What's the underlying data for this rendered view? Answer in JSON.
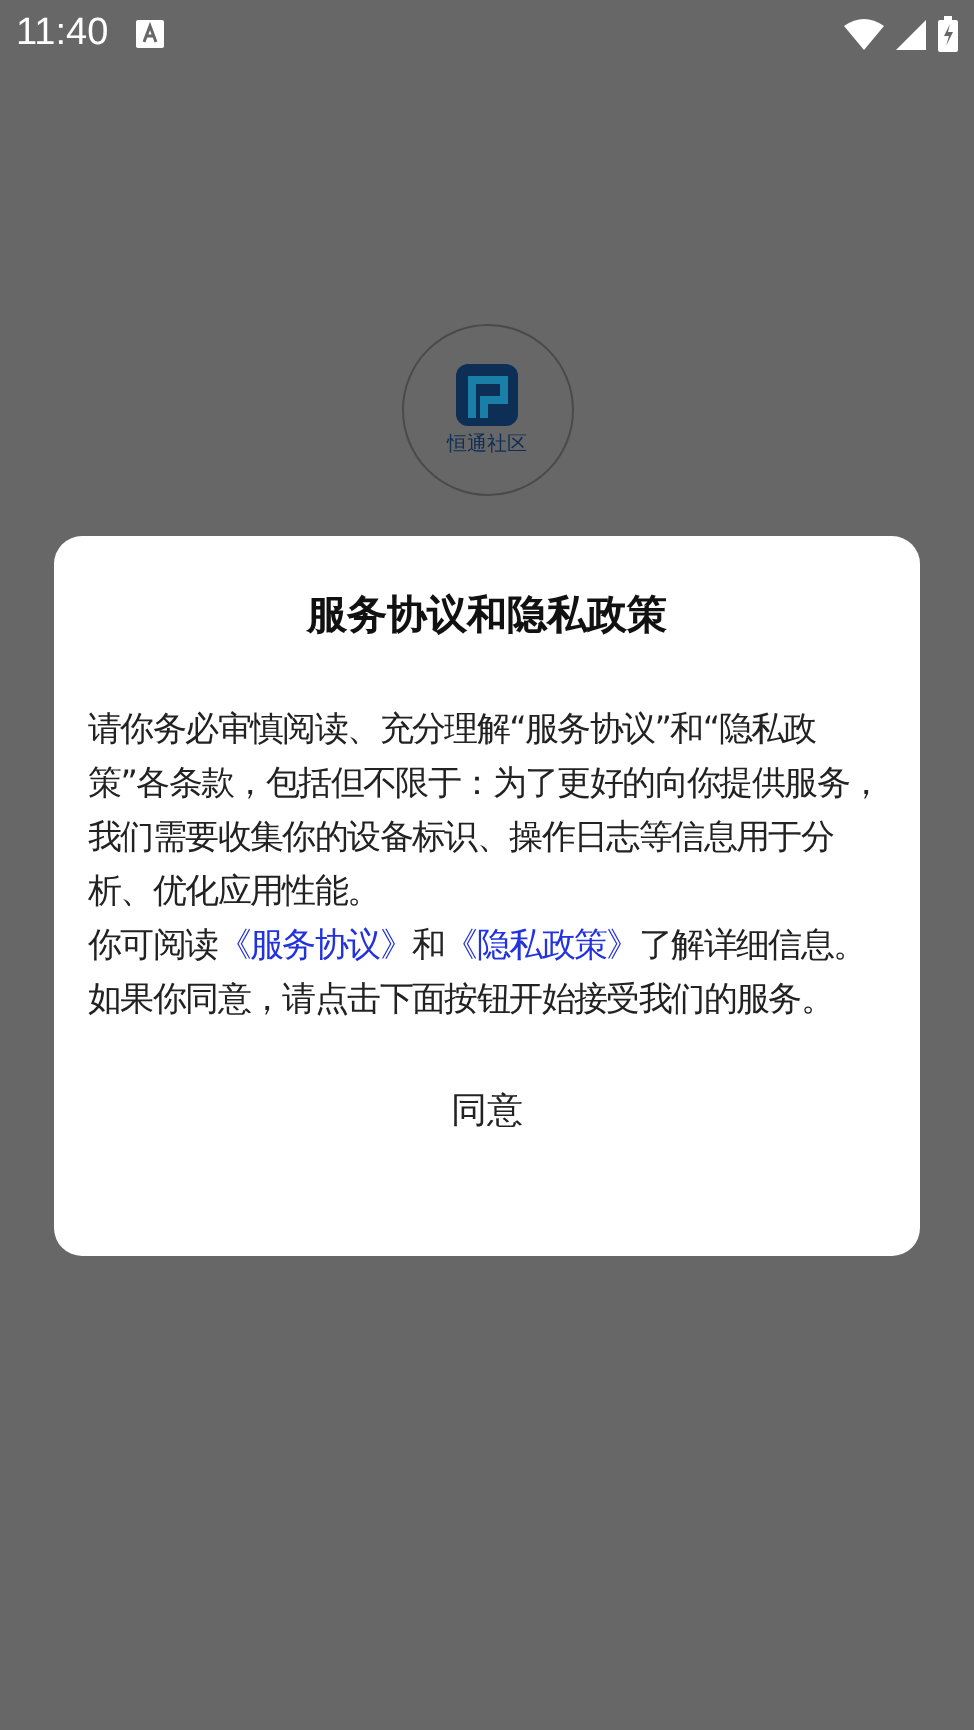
{
  "status_bar": {
    "time": "11:40"
  },
  "splash": {
    "logo_caption": "恒通社区"
  },
  "dialog": {
    "title": "服务协议和隐私政策",
    "paragraphs": [
      [
        {
          "kind": "text",
          "text": "请你务必审慎阅读、充分理解“服务协议”和“隐私政策”各条款，包括但不限于：为了更好的向你提供服务，我们需要收集你的设备标识、操作日志等信息用于分析、优化应用性能。"
        }
      ],
      [
        {
          "kind": "text",
          "text": "你可阅读"
        },
        {
          "kind": "link",
          "text": "《服务协议》"
        },
        {
          "kind": "text",
          "text": "和"
        },
        {
          "kind": "link",
          "text": "《隐私政策》"
        },
        {
          "kind": "text",
          "text": "了解详细信息。如果你同意，请点击下面按钮开始接受我们的服务。"
        }
      ]
    ],
    "button": "同意"
  }
}
